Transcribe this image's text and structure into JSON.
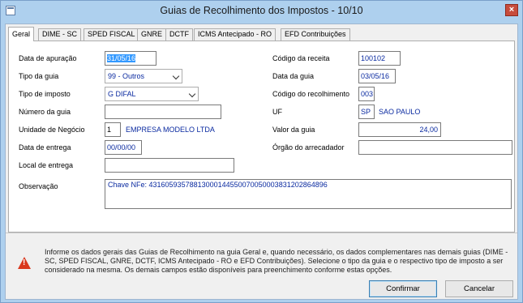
{
  "window": {
    "title": "Guias de Recolhimento dos Impostos - 10/10",
    "close_glyph": "×"
  },
  "tabs": [
    {
      "label": "Geral"
    },
    {
      "label": "DIME - SC"
    },
    {
      "label": "SPED FISCAL"
    },
    {
      "label": "GNRE"
    },
    {
      "label": "DCTF"
    },
    {
      "label": "ICMS Antecipado - RO"
    },
    {
      "label": "EFD Contribuições"
    }
  ],
  "form": {
    "data_apuracao": {
      "label": "Data de apuração",
      "value": "31/05/16"
    },
    "tipo_guia": {
      "label": "Tipo da guia",
      "value": "99 - Outros"
    },
    "tipo_imposto": {
      "label": "Tipo de imposto",
      "value": "G DIFAL"
    },
    "numero_guia": {
      "label": "Número da guia",
      "value": ""
    },
    "unidade_negocio": {
      "label": "Unidade de Negócio",
      "code": "1",
      "name": "EMPRESA MODELO LTDA"
    },
    "data_entrega": {
      "label": "Data de entrega",
      "value": "00/00/00"
    },
    "local_entrega": {
      "label": "Local de entrega",
      "value": ""
    },
    "codigo_receita": {
      "label": "Código da receita",
      "value": "100102"
    },
    "data_guia": {
      "label": "Data da guia",
      "value": "03/05/16"
    },
    "codigo_recolhimento": {
      "label": "Código do recolhimento",
      "value": "003"
    },
    "uf": {
      "label": "UF",
      "code": "SP",
      "name": "SAO PAULO"
    },
    "valor_guia": {
      "label": "Valor da guia",
      "value": "24,00"
    },
    "orgao_arrecadador": {
      "label": "Órgão do arrecadador",
      "value": ""
    },
    "observacao": {
      "label": "Observação",
      "value": "Chave NFe: 43160593578813000144550070050003831202864896"
    }
  },
  "info": {
    "icon": "warning-icon",
    "text": "Informe os dados gerais das Guias de Recolhimento na guia Geral e, quando necessário, os dados complementares nas demais guias (DIME - SC, SPED FISCAL, GNRE, DCTF, ICMS Antecipado - RO e EFD Contribuições). Selecione o tipo da guia e o respectivo tipo de imposto a ser considerado na mesma. Os demais campos estão disponíveis para preenchimento conforme estas opções."
  },
  "buttons": {
    "confirm": "Confirmar",
    "cancel": "Cancelar"
  }
}
